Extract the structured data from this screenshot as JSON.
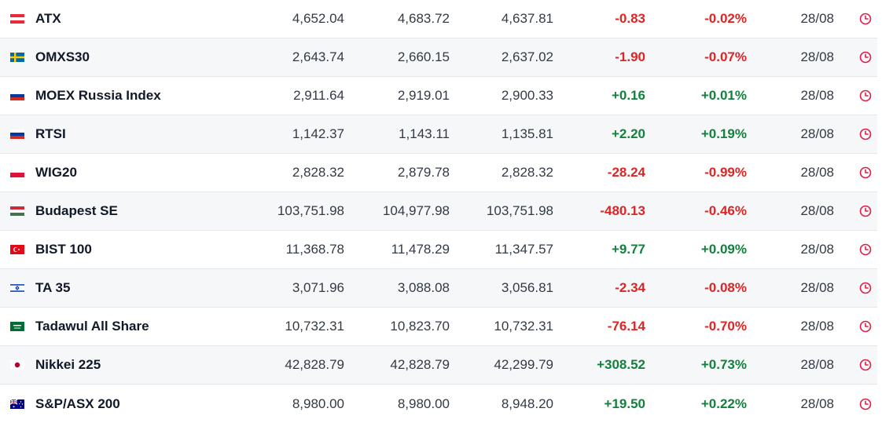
{
  "colors": {
    "negative": "#dc2626",
    "positive": "#15803d",
    "clock": "#e11d48",
    "row_alt": "#f6f7f9"
  },
  "rows": [
    {
      "name": "ATX",
      "flag": "austria-flag-icon",
      "last": "4,652.04",
      "high": "4,683.72",
      "low": "4,637.81",
      "chg": "-0.83",
      "pct": "-0.02%",
      "date": "28/08",
      "dir": "neg"
    },
    {
      "name": "OMXS30",
      "flag": "sweden-flag-icon",
      "last": "2,643.74",
      "high": "2,660.15",
      "low": "2,637.02",
      "chg": "-1.90",
      "pct": "-0.07%",
      "date": "28/08",
      "dir": "neg"
    },
    {
      "name": "MOEX Russia Index",
      "flag": "russia-flag-icon",
      "last": "2,911.64",
      "high": "2,919.01",
      "low": "2,900.33",
      "chg": "+0.16",
      "pct": "+0.01%",
      "date": "28/08",
      "dir": "pos"
    },
    {
      "name": "RTSI",
      "flag": "russia-flag-icon",
      "last": "1,142.37",
      "high": "1,143.11",
      "low": "1,135.81",
      "chg": "+2.20",
      "pct": "+0.19%",
      "date": "28/08",
      "dir": "pos"
    },
    {
      "name": "WIG20",
      "flag": "poland-flag-icon",
      "last": "2,828.32",
      "high": "2,879.78",
      "low": "2,828.32",
      "chg": "-28.24",
      "pct": "-0.99%",
      "date": "28/08",
      "dir": "neg"
    },
    {
      "name": "Budapest SE",
      "flag": "hungary-flag-icon",
      "last": "103,751.98",
      "high": "104,977.98",
      "low": "103,751.98",
      "chg": "-480.13",
      "pct": "-0.46%",
      "date": "28/08",
      "dir": "neg"
    },
    {
      "name": "BIST 100",
      "flag": "turkey-flag-icon",
      "last": "11,368.78",
      "high": "11,478.29",
      "low": "11,347.57",
      "chg": "+9.77",
      "pct": "+0.09%",
      "date": "28/08",
      "dir": "pos"
    },
    {
      "name": "TA 35",
      "flag": "israel-flag-icon",
      "last": "3,071.96",
      "high": "3,088.08",
      "low": "3,056.81",
      "chg": "-2.34",
      "pct": "-0.08%",
      "date": "28/08",
      "dir": "neg"
    },
    {
      "name": "Tadawul All Share",
      "flag": "saudi-arabia-flag-icon",
      "last": "10,732.31",
      "high": "10,823.70",
      "low": "10,732.31",
      "chg": "-76.14",
      "pct": "-0.70%",
      "date": "28/08",
      "dir": "neg"
    },
    {
      "name": "Nikkei 225",
      "flag": "japan-flag-icon",
      "last": "42,828.79",
      "high": "42,828.79",
      "low": "42,299.79",
      "chg": "+308.52",
      "pct": "+0.73%",
      "date": "28/08",
      "dir": "pos"
    },
    {
      "name": "S&P/ASX 200",
      "flag": "australia-flag-icon",
      "last": "8,980.00",
      "high": "8,980.00",
      "low": "8,948.20",
      "chg": "+19.50",
      "pct": "+0.22%",
      "date": "28/08",
      "dir": "pos"
    }
  ]
}
